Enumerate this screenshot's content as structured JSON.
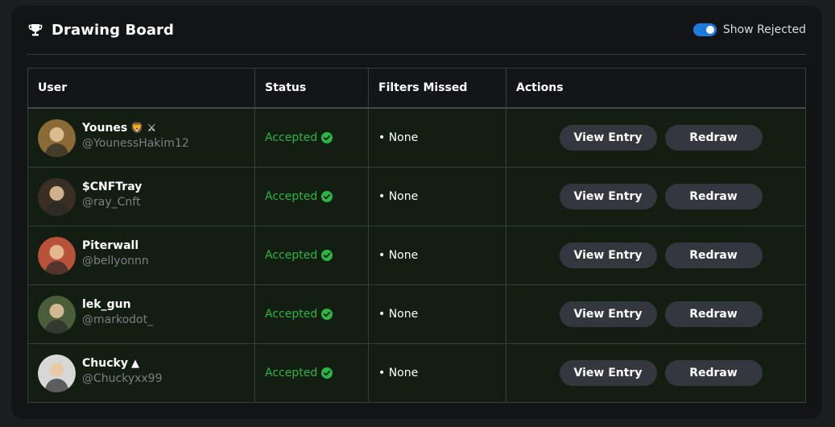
{
  "header": {
    "title": "Drawing Board",
    "icon": "trophy-icon",
    "toggle_label": "Show Rejected",
    "toggle_on": true,
    "accent": "#1f7ae0"
  },
  "table": {
    "columns": [
      "User",
      "Status",
      "Filters Missed",
      "Actions"
    ],
    "rows": [
      {
        "name": "Younes",
        "emoji": "🦁 ⚔",
        "handle": "@YounessHakim12",
        "status": "Accepted",
        "filters": "• None",
        "view_label": "View Entry",
        "redraw_label": "Redraw",
        "avatar_color": "#8a6a35"
      },
      {
        "name": "$CNFTray",
        "emoji": "",
        "handle": "@ray_Cnft",
        "status": "Accepted",
        "filters": "• None",
        "view_label": "View Entry",
        "redraw_label": "Redraw",
        "avatar_color": "#3b2f24"
      },
      {
        "name": "Piterwall",
        "emoji": "",
        "handle": "@bellyonnn",
        "status": "Accepted",
        "filters": "• None",
        "view_label": "View Entry",
        "redraw_label": "Redraw",
        "avatar_color": "#b8513a"
      },
      {
        "name": "lek_gun",
        "emoji": "",
        "handle": "@markodot_",
        "status": "Accepted",
        "filters": "• None",
        "view_label": "View Entry",
        "redraw_label": "Redraw",
        "avatar_color": "#4b5e3a"
      },
      {
        "name": "Chucky",
        "emoji": "▲",
        "handle": "@Chuckyxx99",
        "status": "Accepted",
        "filters": "• None",
        "view_label": "View Entry",
        "redraw_label": "Redraw",
        "avatar_color": "#d7d7d7"
      }
    ]
  },
  "colors": {
    "status_accepted": "#2fb344",
    "row_bg": "#131e12",
    "button_bg": "#34373d"
  }
}
